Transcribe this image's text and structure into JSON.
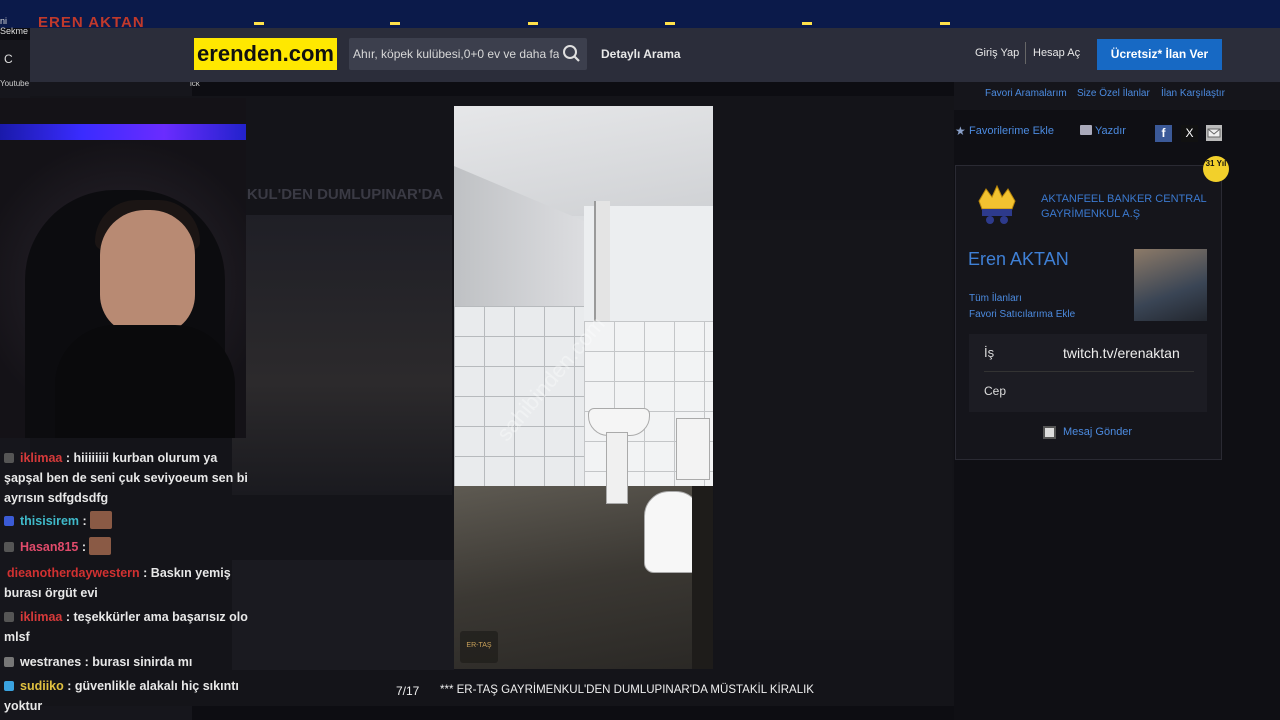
{
  "browser": {
    "tab_label": "ni Sekme",
    "brand_hidden": "EREN AKTAN",
    "reload_glyph": "C",
    "bookmark_left": "Youtube",
    "bookmark_right": "ick"
  },
  "header": {
    "logo": "erenden.com",
    "search_placeholder": "Ahır, köpek kulübesi,0+0 ev ve daha fazlası",
    "detailed_search": "Detaylı Arama",
    "login": "Giriş Yap",
    "register": "Hesap Aç",
    "post_ad": "Ücretsiz* İlan Ver"
  },
  "subnav": {
    "links": [
      "Favori Aramalarım",
      "Size Özel İlanlar",
      "İlan Karşılaştır"
    ]
  },
  "dimmed_page": {
    "title_fragment": "NKUL'DEN DUMLUPINAR'DA"
  },
  "chat": {
    "messages": [
      {
        "user": "iklimaa",
        "user_color": "#d63a3a",
        "text": "hiiiiiiii kurban olurum ya şapşal ben de seni çuk seviyoeum sen bi ayrısın sdfgdsdfg",
        "badge_color": "#555555"
      },
      {
        "user": "thisisirem",
        "user_color": "#3fb9c9",
        "text": "",
        "emote": true,
        "badge_color": "#3b5bd6"
      },
      {
        "user": "Hasan815",
        "user_color": "#e04b6b",
        "text": "",
        "emote": true,
        "badge_color": "#555555"
      },
      {
        "user": "dieanotherdaywestern",
        "user_color": "#d13131",
        "text": "Baskın yemiş burası örgüt evi",
        "badge_color": ""
      },
      {
        "user": "iklimaa",
        "user_color": "#d63a3a",
        "text": "teşekkürler ama başarısız olo mlsf",
        "badge_color": "#555555"
      },
      {
        "user": "westranes",
        "user_color": "#e8e8e8",
        "text": "burası sinirda mı",
        "badge_color": "#777777"
      },
      {
        "user": "sudiiko",
        "user_color": "#e0c040",
        "text": "güvenlikle alakalı hiç sıkıntı yoktur",
        "badge_color": "#3aa3e0"
      }
    ]
  },
  "lightbox": {
    "watermark": "sahibinden.com",
    "photo_logo": "ER-TAŞ",
    "counter": "7/17",
    "caption": "*** ER-TAŞ GAYRİMENKUL'DEN DUMLUPINAR'DA MÜSTAKİL KİRALIK"
  },
  "actions": {
    "favorite": "Favorilerime Ekle",
    "print": "Yazdır",
    "share_facebook": "f",
    "share_x": "X"
  },
  "seller": {
    "years_badge": "31 Yıl",
    "company": "AKTANFEEL BANKER CENTRAL GAYRİMENKUL A.Ş",
    "agent_name": "Eren AKTAN",
    "all_listings": "Tüm İlanları",
    "add_favorite_seller": "Favori Satıcılarıma Ekle",
    "work_label": "İş",
    "work_value": "twitch.tv/erenaktan",
    "mobile_label": "Cep",
    "send_message": "Mesaj Gönder"
  },
  "colors": {
    "accent_blue": "#1769c4",
    "link_blue": "#4c8be0",
    "logo_yellow": "#ffe800"
  }
}
